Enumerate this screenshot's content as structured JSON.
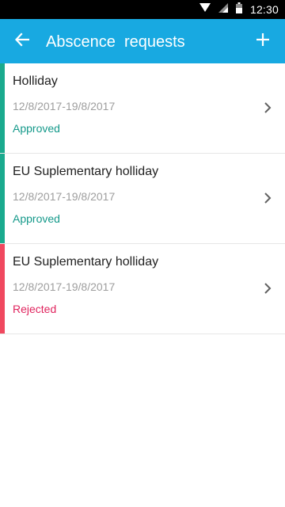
{
  "status_bar": {
    "time": "12:30",
    "icons": [
      "wifi-icon",
      "signal-icon",
      "battery-icon"
    ]
  },
  "app_bar": {
    "title": "Abscence  requests",
    "back_icon": "arrow-left-icon",
    "add_icon": "plus-icon",
    "color": "#18a9e1"
  },
  "requests": [
    {
      "title": "Holliday",
      "dates": "12/8/2017-19/8/2017",
      "status": "Approved",
      "status_color": "#14998a",
      "stripe_color": "#1aaa8e"
    },
    {
      "title": "EU Suplementary holliday",
      "dates": "12/8/2017-19/8/2017",
      "status": "Approved",
      "status_color": "#14998a",
      "stripe_color": "#1aaa8e"
    },
    {
      "title": "EU Suplementary holliday",
      "dates": "12/8/2017-19/8/2017",
      "status": "Rejected",
      "status_color": "#e0245e",
      "stripe_color": "#f0485f"
    }
  ]
}
